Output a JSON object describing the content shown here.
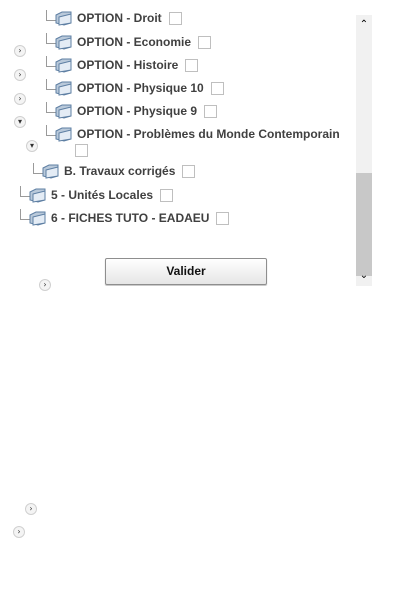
{
  "tree": {
    "items": [
      {
        "label": "OPTION - Droit"
      },
      {
        "label": "OPTION - Economie"
      },
      {
        "label": "OPTION - Histoire"
      },
      {
        "label": "OPTION - Physique 10"
      },
      {
        "label": "OPTION - Physique 9"
      },
      {
        "label": "OPTION - Problèmes du Monde Contemporain"
      },
      {
        "label": "B. Travaux corrigés"
      },
      {
        "label": "5 - Unités Locales"
      },
      {
        "label": "6 - FICHES TUTO - EADAEU"
      }
    ]
  },
  "validate_button": {
    "label": "Valider"
  },
  "icons": {
    "expand": "chevron-right-icon",
    "collapse": "collapse-icon",
    "folder": "folder-icon",
    "scroll_up": "scroll-up-icon",
    "scroll_down": "scroll-down-icon"
  },
  "colors": {
    "label": "#404040",
    "checkbox_border": "#bfbfbf",
    "scroll_thumb": "#c8c8c8"
  }
}
